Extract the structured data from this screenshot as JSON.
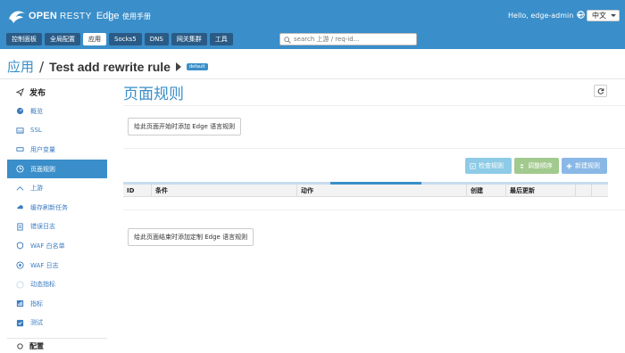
{
  "brand": {
    "name_bold": "OPEN",
    "name_light": "RESTY",
    "product": "Edge"
  },
  "header": {
    "separator": "|",
    "manual": "使用手册",
    "greeting": "Hello, edge-admin",
    "language": "中文"
  },
  "tabs": [
    {
      "label": "控制面板",
      "active": false
    },
    {
      "label": "全局配置",
      "active": false
    },
    {
      "label": "应用",
      "active": true
    },
    {
      "label": "Socks5",
      "active": false
    },
    {
      "label": "DNS",
      "active": false
    },
    {
      "label": "网关集群",
      "active": false
    },
    {
      "label": "工具",
      "active": false
    }
  ],
  "search": {
    "placeholder": "search 上游 / req-id..."
  },
  "breadcrumb": {
    "root": "应用",
    "separator": "/",
    "app_name": "Test add rewrite rule",
    "badge": "default"
  },
  "sidebar": {
    "section_publish": "发布",
    "items": [
      {
        "label": "概览",
        "icon": "dashboard-icon"
      },
      {
        "label": "SSL",
        "icon": "ssl-icon"
      },
      {
        "label": "用户变量",
        "icon": "variable-icon"
      },
      {
        "label": "页面规则",
        "icon": "clock-icon",
        "active": true
      },
      {
        "label": "上游",
        "icon": "upstream-icon"
      },
      {
        "label": "缓存刷新任务",
        "icon": "cache-icon"
      },
      {
        "label": "错误日志",
        "icon": "log-icon"
      },
      {
        "label": "WAF 白名单",
        "icon": "shield-icon"
      },
      {
        "label": "WAF 日志",
        "icon": "waf-log-icon"
      },
      {
        "label": "动态指标",
        "icon": "dynamic-metrics-icon"
      },
      {
        "label": "指标",
        "icon": "metrics-icon"
      },
      {
        "label": "测试",
        "icon": "test-icon"
      }
    ],
    "section_config": "配置"
  },
  "main": {
    "title": "页面规则",
    "add_begin_button": "给此页面开始时添加 Edge 语言规则",
    "check_button": "检查规则",
    "order_button": "调整顺序",
    "new_button": "新建规则",
    "table_headers": [
      "ID",
      "条件",
      "动作",
      "创建",
      "最后更新",
      "",
      ""
    ],
    "add_end_button": "给此页面结束时添加定制 Edge 语言规则"
  },
  "colors": {
    "primary": "#3a8ec9",
    "nav_dark": "#2a5b86",
    "check": "#8dcbe6",
    "order": "#a2c98e",
    "new": "#8ab8e6"
  }
}
